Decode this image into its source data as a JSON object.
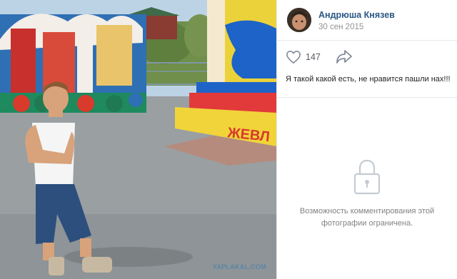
{
  "post": {
    "author_name": "Андрюша Князев",
    "date": "30 сен 2015",
    "likes": "147",
    "caption": "Я такой какой есть, не нравится пашли нах!!!"
  },
  "comments": {
    "restricted_line1": "Возможность комментирования этой",
    "restricted_line2": "фотографии ограничена."
  },
  "photo": {
    "bouncy_text": "ЖЕВЛ",
    "watermark": "YAPLAKAL.COM"
  },
  "icons": {
    "like": "heart-icon",
    "share": "share-arrow-icon",
    "restricted": "lock-icon"
  },
  "colors": {
    "author_link": "#2a5885",
    "muted": "#939393",
    "divider": "#e7e8ec"
  }
}
